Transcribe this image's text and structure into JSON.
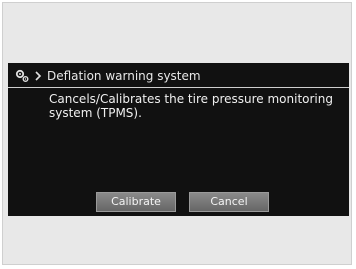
{
  "header": {
    "icon": "settings-gear-icon",
    "chevron_icon": "chevron-right-icon",
    "title": "Deflation warning system"
  },
  "body": {
    "description": "Cancels/Calibrates the tire pressure monitoring system (TPMS)."
  },
  "buttons": {
    "calibrate_label": "Calibrate",
    "cancel_label": "Cancel"
  },
  "colors": {
    "screen_background": "#111111",
    "button_background": "#777777",
    "text": "#f0f0f0",
    "frame_background": "#e8e8e8"
  }
}
